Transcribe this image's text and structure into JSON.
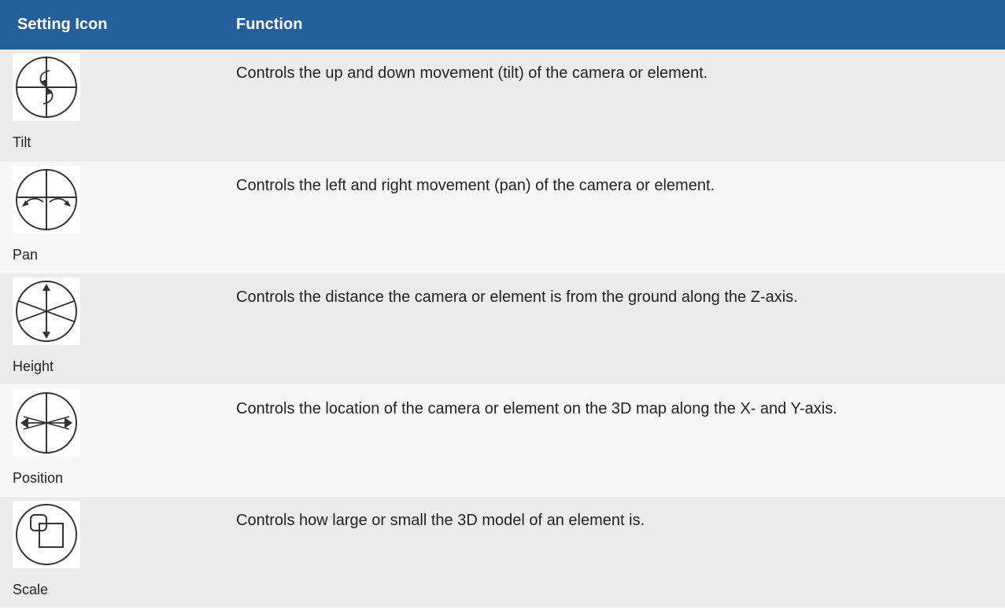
{
  "table": {
    "header": {
      "col1": "Setting Icon",
      "col2": "Function"
    },
    "rows": [
      {
        "icon": "tilt-icon",
        "label": "Tilt",
        "function": "Controls the up and down movement (tilt) of the camera or element."
      },
      {
        "icon": "pan-icon",
        "label": "Pan",
        "function": "Controls the left and right movement (pan) of the camera or element."
      },
      {
        "icon": "height-icon",
        "label": "Height",
        "function": "Controls the distance the camera or element is from the ground along the Z-axis."
      },
      {
        "icon": "position-icon",
        "label": "Position",
        "function": "Controls the location of the camera or element on the 3D map along the X- and Y-axis."
      },
      {
        "icon": "scale-icon",
        "label": "Scale",
        "function": "Controls how large or small the 3D model of an element is."
      }
    ]
  },
  "colors": {
    "header_bg": "#23609b",
    "header_text": "#ffffff",
    "row_odd": "#ebebeb",
    "row_even": "#f7f7f7"
  }
}
